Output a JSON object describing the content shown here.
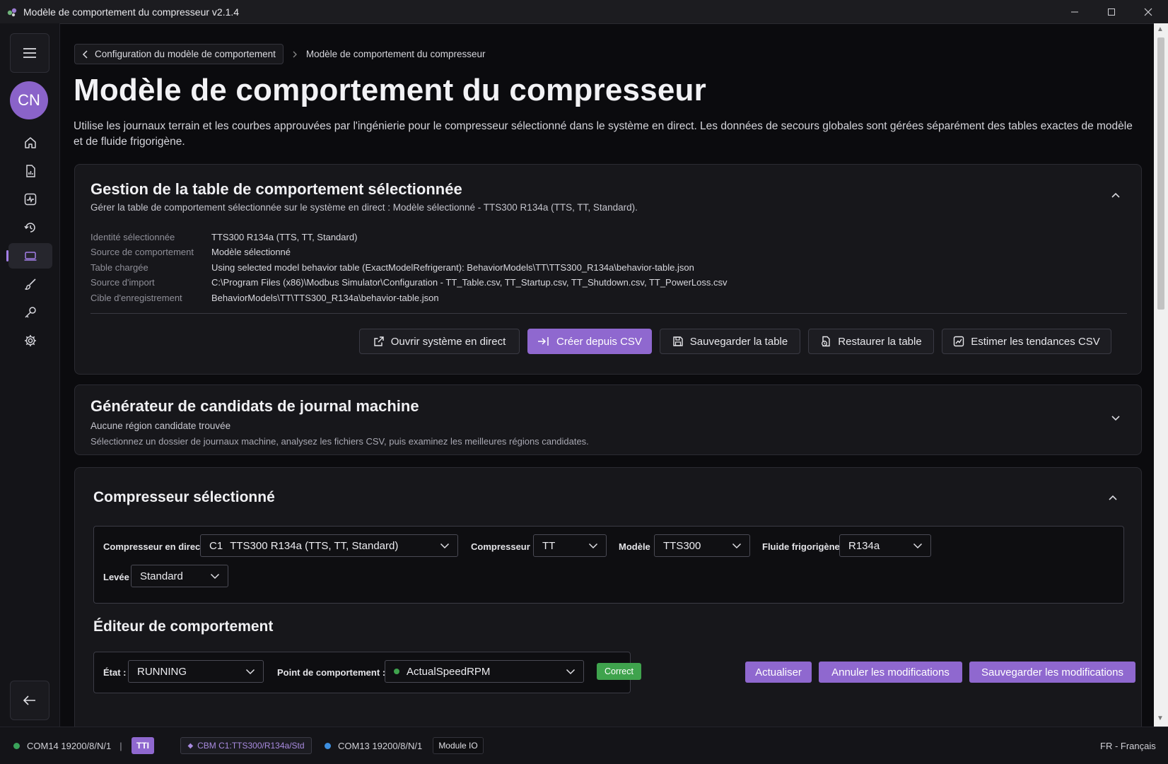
{
  "window": {
    "title": "Modèle de comportement du compresseur v2.1.4"
  },
  "rail": {
    "avatar_initials": "CN",
    "nav": [
      "home-icon",
      "report-icon",
      "activity-icon",
      "history-icon",
      "device-icon",
      "brush-icon",
      "key-icon",
      "gear-icon"
    ],
    "active_index": 4
  },
  "breadcrumb": {
    "back_label": "Configuration du modèle de comportement",
    "current": "Modèle de comportement du compresseur"
  },
  "page": {
    "title": "Modèle de comportement du compresseur",
    "description": "Utilise les journaux terrain et les courbes approuvées par l'ingénierie pour le compresseur sélectionné dans le système en direct. Les données de secours globales sont gérées séparément des tables exactes de modèle et de fluide frigorigène."
  },
  "table_card": {
    "title": "Gestion de la table de comportement sélectionnée",
    "subtitle": "Gérer la table de comportement sélectionnée sur le système en direct : Modèle sélectionné - TTS300 R134a (TTS, TT, Standard).",
    "rows": [
      {
        "key": "Identité sélectionnée",
        "value": "TTS300 R134a (TTS, TT, Standard)"
      },
      {
        "key": "Source de comportement",
        "value": "Modèle sélectionné"
      },
      {
        "key": "Table chargée",
        "value": "Using selected model behavior table (ExactModelRefrigerant): BehaviorModels\\TT\\TTS300_R134a\\behavior-table.json"
      },
      {
        "key": "Source d'import",
        "value": "C:\\Program Files (x86)\\Modbus Simulator\\Configuration - TT_Table.csv, TT_Startup.csv, TT_Shutdown.csv, TT_PowerLoss.csv"
      },
      {
        "key": "Cible d'enregistrement",
        "value": "BehaviorModels\\TT\\TTS300_R134a\\behavior-table.json"
      }
    ],
    "buttons": {
      "open_live": "Ouvrir système en direct",
      "create_csv": "Créer depuis CSV",
      "save_table": "Sauvegarder la table",
      "restore_table": "Restaurer la table",
      "estimate_csv": "Estimer les tendances CSV"
    }
  },
  "generator_card": {
    "title": "Générateur de candidats de journal machine",
    "status": "Aucune région candidate trouvée",
    "hint": "Sélectionnez un dossier de journaux machine, analysez les fichiers CSV, puis examinez les meilleures régions candidates."
  },
  "compressor_card": {
    "title": "Compresseur sélectionné",
    "live_label": "Compresseur en direct",
    "live_value_code": "C1",
    "live_value": "TTS300 R134a (TTS, TT, Standard)",
    "compressor_label": "Compresseur :",
    "compressor_value": "TT",
    "model_label": "Modèle",
    "model_value": "TTS300",
    "fluid_label": "Fluide frigorigène",
    "fluid_value": "R134a",
    "lift_label": "Levée",
    "lift_value": "Standard"
  },
  "editor": {
    "title": "Éditeur de comportement",
    "state_label": "État :",
    "state_value": "RUNNING",
    "point_label": "Point de comportement :",
    "point_value": "ActualSpeedRPM",
    "badge": "Correct",
    "refresh": "Actualiser",
    "cancel": "Annuler les modifications",
    "save": "Sauvegarder les modifications"
  },
  "statusbar": {
    "port1": "COM14 19200/8/N/1",
    "sep": "|",
    "chip1": "TTI",
    "chip2": "CBM C1:TTS300/R134a/Std",
    "port2": "COM13 19200/8/N/1",
    "module": "Module IO",
    "lang": "FR - Français"
  },
  "colors": {
    "accent": "#8f68cf",
    "ok": "#3fa34d",
    "port1_dot": "#3aa35a",
    "port2_dot": "#3d8fe0"
  }
}
